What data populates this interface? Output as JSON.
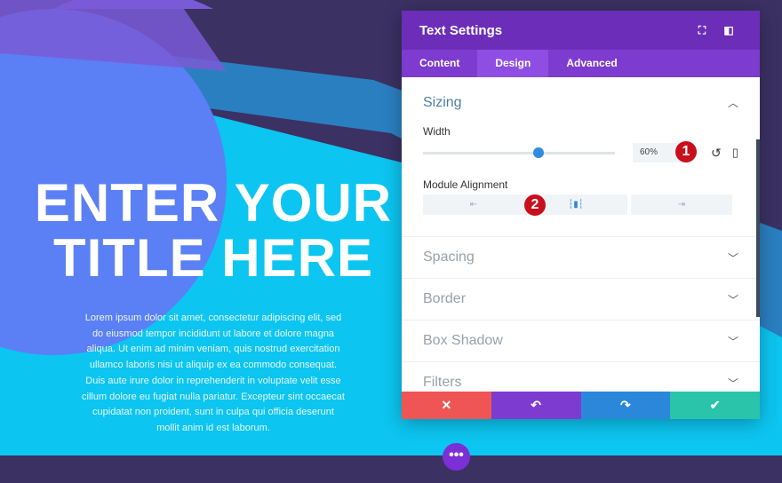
{
  "hero": {
    "title_line1": "ENTER YOUR",
    "title_line2": "TITLE HERE",
    "body_lines": [
      "Lorem ipsum dolor sit amet, consectetur adipiscing elit, sed",
      "do eiusmod tempor incididunt ut labore et dolore magna",
      "aliqua. Ut enim ad minim veniam, quis nostrud exercitation",
      "ullamco laboris nisi ut aliquip ex ea commodo consequat.",
      "Duis aute irure dolor in reprehenderit in voluptate velit esse",
      "cillum dolore eu fugiat nulla pariatur. Excepteur sint occaecat",
      "cupidatat non proident, sunt in culpa qui officia deserunt",
      "mollit anim id est laborum."
    ]
  },
  "panel": {
    "title": "Text Settings",
    "tabs": [
      {
        "label": "Content"
      },
      {
        "label": "Design"
      },
      {
        "label": "Advanced"
      }
    ],
    "sizing": {
      "title": "Sizing",
      "width_label": "Width",
      "width_value": "60%",
      "width_percent": 60,
      "alignment_label": "Module Alignment",
      "alignment_selected": "center"
    },
    "sections": [
      {
        "label": "Spacing"
      },
      {
        "label": "Border"
      },
      {
        "label": "Box Shadow"
      },
      {
        "label": "Filters"
      }
    ],
    "badges": [
      "1",
      "2"
    ]
  },
  "colors": {
    "header": "#6c2eb9",
    "tab_active": "#8e4ee3",
    "cancel": "#ef5555",
    "undo": "#7e3bd0",
    "redo": "#2b87da",
    "save": "#29c4a9",
    "accent": "#2e8be0"
  },
  "more_label": "•••"
}
